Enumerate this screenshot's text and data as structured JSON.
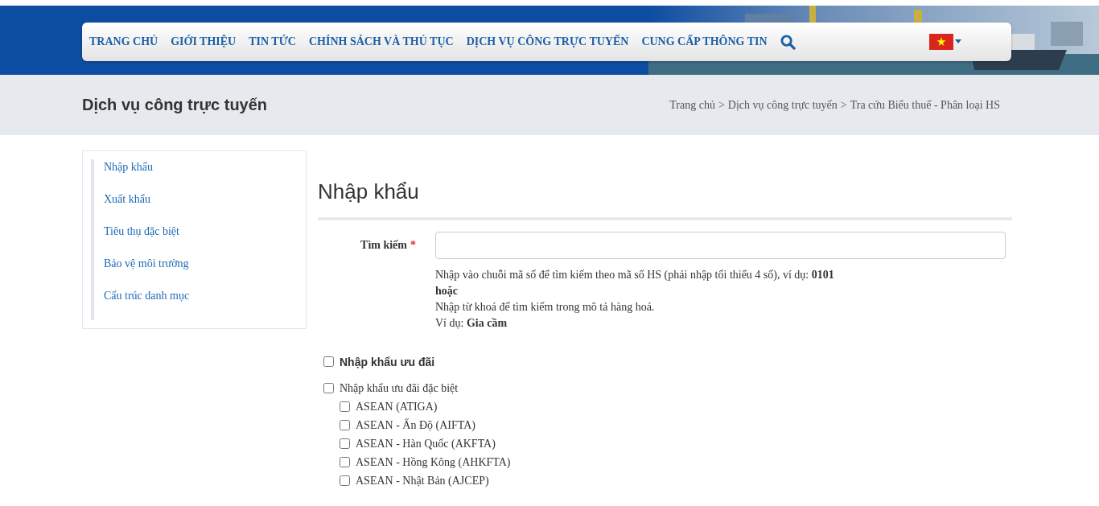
{
  "nav": {
    "items": [
      {
        "label": "TRANG CHỦ"
      },
      {
        "label": "GIỚI THIỆU"
      },
      {
        "label": "TIN TỨC"
      },
      {
        "label": "CHÍNH SÁCH VÀ THỦ TỤC"
      },
      {
        "label": "DỊCH VỤ CÔNG TRỰC TUYẾN"
      },
      {
        "label": "CUNG CẤP THÔNG TIN"
      }
    ]
  },
  "page_header": {
    "title": "Dịch vụ công trực tuyến",
    "breadcrumb": [
      "Trang chủ",
      ">",
      "Dịch vụ công trực tuyến",
      ">",
      "Tra cứu Biểu thuế - Phân loại HS"
    ]
  },
  "sidebar": {
    "items": [
      {
        "label": "Nhập khẩu"
      },
      {
        "label": "Xuất khẩu"
      },
      {
        "label": "Tiêu thụ đặc biệt"
      },
      {
        "label": "Bảo vệ môi trường"
      },
      {
        "label": "Cấu trúc danh mục"
      }
    ]
  },
  "content": {
    "title": "Nhập khẩu",
    "search": {
      "label": "Tìm kiếm",
      "required_mark": "*"
    },
    "hints": [
      "Nhập vào chuỗi mã số để tìm kiếm theo mã số HS (phải nhập tối thiểu 4 số), ví dụ: **0101**",
      "**hoặc**",
      "Nhập từ khoá để tìm kiếm trong mô tả hàng hoá.",
      "Ví dụ: **Gia cầm**"
    ],
    "options": [
      {
        "label": "Nhập khẩu ưu đãi",
        "kind": "heading",
        "checked": false
      },
      {
        "label": "Nhập khẩu ưu đãi đặc biệt",
        "kind": "group",
        "checked": false
      },
      {
        "label": "ASEAN (ATIGA)",
        "kind": "sub",
        "checked": false
      },
      {
        "label": "ASEAN - Ấn Độ (AIFTA)",
        "kind": "sub",
        "checked": false
      },
      {
        "label": "ASEAN - Hàn Quốc (AKFTA)",
        "kind": "sub",
        "checked": false
      },
      {
        "label": "ASEAN - Hồng Kông (AHKFTA)",
        "kind": "sub",
        "checked": false
      },
      {
        "label": "ASEAN - Nhật Bản (AJCEP)",
        "kind": "sub",
        "checked": false
      }
    ]
  }
}
